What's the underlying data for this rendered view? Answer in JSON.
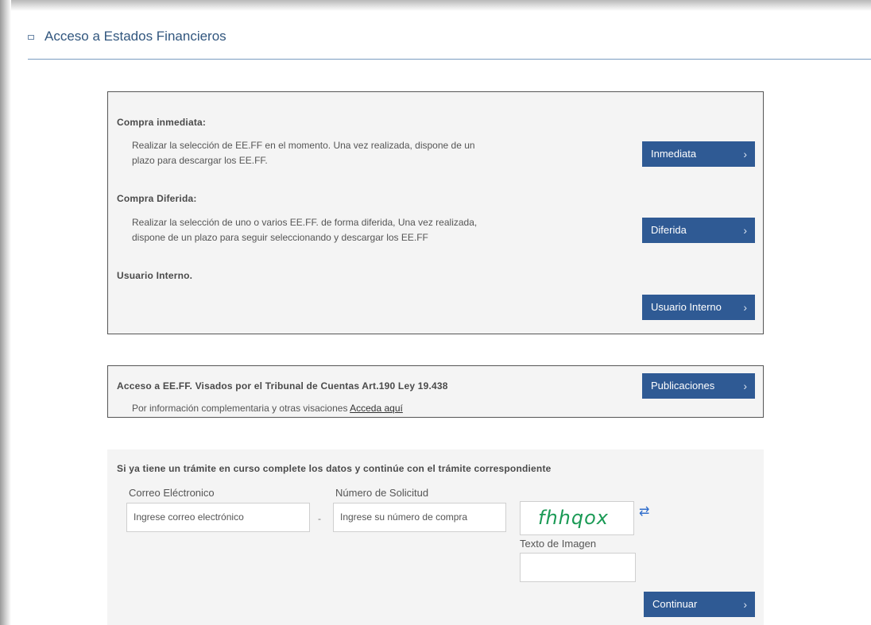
{
  "header": {
    "title": "Acceso a Estados Financieros"
  },
  "purchase_options": {
    "immediate": {
      "title": "Compra inmediata:",
      "description_line1": "Realizar la selección de EE.FF en el momento. Una vez realizada, dispone de un",
      "description_line2": "plazo para descargar los EE.FF.",
      "button": "Inmediata"
    },
    "deferred": {
      "title": "Compra Diferida:",
      "description_line1": "Realizar la selección de uno o varios EE.FF. de forma diferida, Una vez realizada,",
      "description_line2": "dispone de un plazo para seguir seleccionando y descargar los EE.FF",
      "button": "Diferida"
    },
    "internal_user": {
      "title": "Usuario Interno.",
      "button": "Usuario Interno"
    }
  },
  "publications": {
    "title": "Acceso a EE.FF. Visados por el Tribunal de Cuentas Art.190 Ley 19.438",
    "info_text": "Por información complementaria y otras visaciones",
    "info_link": "Acceda aquí",
    "button": "Publicaciones"
  },
  "in_progress": {
    "title": "Si ya tiene un trámite en curso complete los datos y continúe con el trámite correspondiente",
    "email_label": "Correo Eléctronico",
    "email_placeholder": "Ingrese correo electrónico",
    "separator": "-",
    "request_label": "Número de Solicitud",
    "request_placeholder": "Ingrese su número de compra",
    "captcha_text": "fhhqox",
    "captcha_label": "Texto de Imagen",
    "captcha_value": "",
    "button": "Continuar"
  },
  "chevron": "›",
  "refresh_glyph": "⇄",
  "colors": {
    "button": "#2f5a94",
    "title": "#31567e",
    "captcha": "#1a9a55"
  }
}
